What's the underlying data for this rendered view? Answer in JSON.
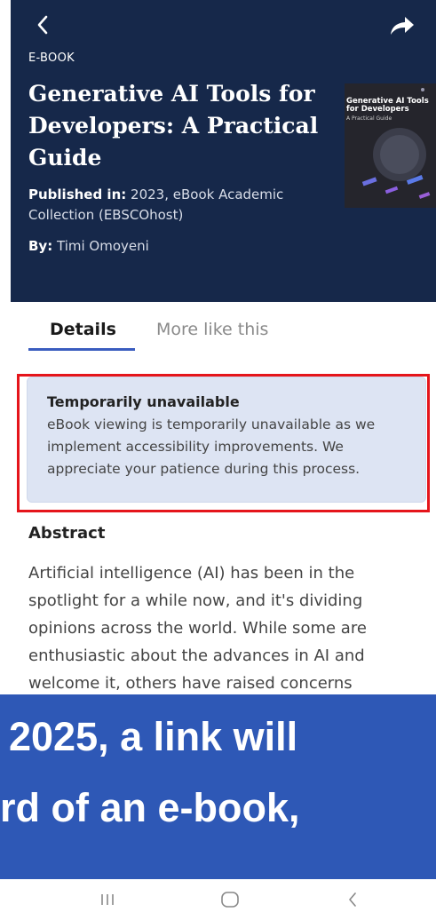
{
  "header": {
    "type_label": "E-BOOK",
    "title": "Generative AI Tools for Developers: A Practical Guide",
    "published_label": "Published in:",
    "published_value": " 2023, eBook Academic Collection (EBSCOhost)",
    "author_label": "By:",
    "author_value": " Timi Omoyeni",
    "cover_title": "Generative AI Tools for Developers",
    "cover_subtitle": "A Practical Guide",
    "back_icon": "chevron-left-icon",
    "share_icon": "share-arrow-icon"
  },
  "tabs": [
    {
      "label": "Details",
      "active": true
    },
    {
      "label": "More like this",
      "active": false
    }
  ],
  "notice": {
    "title": "Temporarily unavailable",
    "body": "eBook viewing is temporarily unavailable as we implement accessibility improvements. We appreciate your patience during this process."
  },
  "abstract": {
    "title": "Abstract",
    "body": "Artificial intelligence (AI) has been in the spotlight for a while now, and it's dividing opinions across the world. While some are enthusiastic about the advances in AI and welcome it, others have raised concerns"
  },
  "caption": {
    "line1": "2025, a link will",
    "line2": "rd of an e-book,"
  },
  "navbar": {
    "recents_icon": "recents-icon",
    "home_icon": "home-icon",
    "back_icon": "back-chevron-icon"
  },
  "colors": {
    "header_bg": "#16284a",
    "notice_bg": "#dde4f3",
    "highlight": "#e5151b",
    "caption_bg": "#2e58b6",
    "tab_accent": "#3a5cbf"
  }
}
